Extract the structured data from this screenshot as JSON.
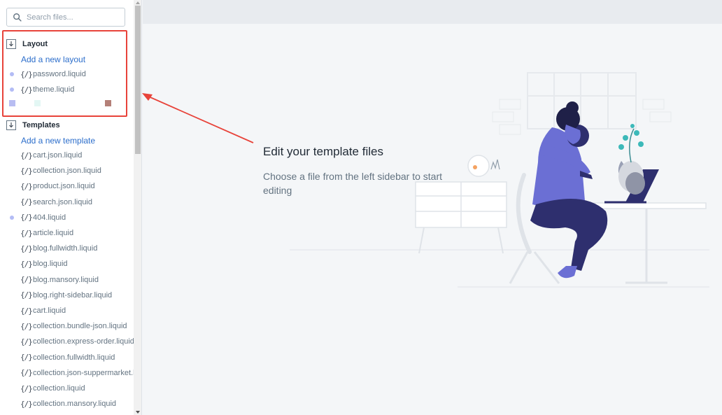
{
  "search": {
    "placeholder": "Search files..."
  },
  "layout_section": {
    "title": "Layout",
    "add_label": "Add a new layout",
    "files": [
      {
        "name": "password.liquid",
        "icon": "{/}",
        "dot": true
      },
      {
        "name": "theme.liquid",
        "icon": "{/}",
        "dot": true
      }
    ]
  },
  "templates_section": {
    "title": "Templates",
    "add_label": "Add a new template",
    "files": [
      {
        "name": "cart.json.liquid",
        "icon": "{/}",
        "dot": false
      },
      {
        "name": "collection.json.liquid",
        "icon": "{/}",
        "dot": false
      },
      {
        "name": "product.json.liquid",
        "icon": "{/}",
        "dot": false
      },
      {
        "name": "search.json.liquid",
        "icon": "{/}",
        "dot": false
      },
      {
        "name": "404.liquid",
        "icon": "{/}",
        "dot": true
      },
      {
        "name": "article.liquid",
        "icon": "{/}",
        "dot": false
      },
      {
        "name": "blog.fullwidth.liquid",
        "icon": "{/}",
        "dot": false
      },
      {
        "name": "blog.liquid",
        "icon": "{/}",
        "dot": false
      },
      {
        "name": "blog.mansory.liquid",
        "icon": "{/}",
        "dot": false
      },
      {
        "name": "blog.right-sidebar.liquid",
        "icon": "{/}",
        "dot": false
      },
      {
        "name": "cart.liquid",
        "icon": "{/}",
        "dot": false
      },
      {
        "name": "collection.bundle-json.liquid",
        "icon": "{/}",
        "dot": false
      },
      {
        "name": "collection.express-order.liquid",
        "icon": "{/}",
        "dot": false
      },
      {
        "name": "collection.fullwidth.liquid",
        "icon": "{/}",
        "dot": false
      },
      {
        "name": "collection.json-suppermarket.liquid",
        "icon": "{/}",
        "dot": false
      },
      {
        "name": "collection.liquid",
        "icon": "{/}",
        "dot": false
      },
      {
        "name": "collection.mansory.liquid",
        "icon": "{/}",
        "dot": false
      }
    ]
  },
  "swatches": [
    "#b8bdf2",
    "#e3f7f4",
    "#b48078"
  ],
  "main": {
    "title": "Edit your template files",
    "description": "Choose a file from the left sidebar to start editing"
  },
  "icons": {
    "search": "search-icon",
    "folder": "folder-download-icon",
    "file": "code-file-icon"
  },
  "colors": {
    "link": "#2c6ecb",
    "highlight": "#e8433a",
    "dot": "#b3bcf5",
    "illustration_primary": "#6b6fd4",
    "illustration_dark": "#2e2f6e"
  }
}
